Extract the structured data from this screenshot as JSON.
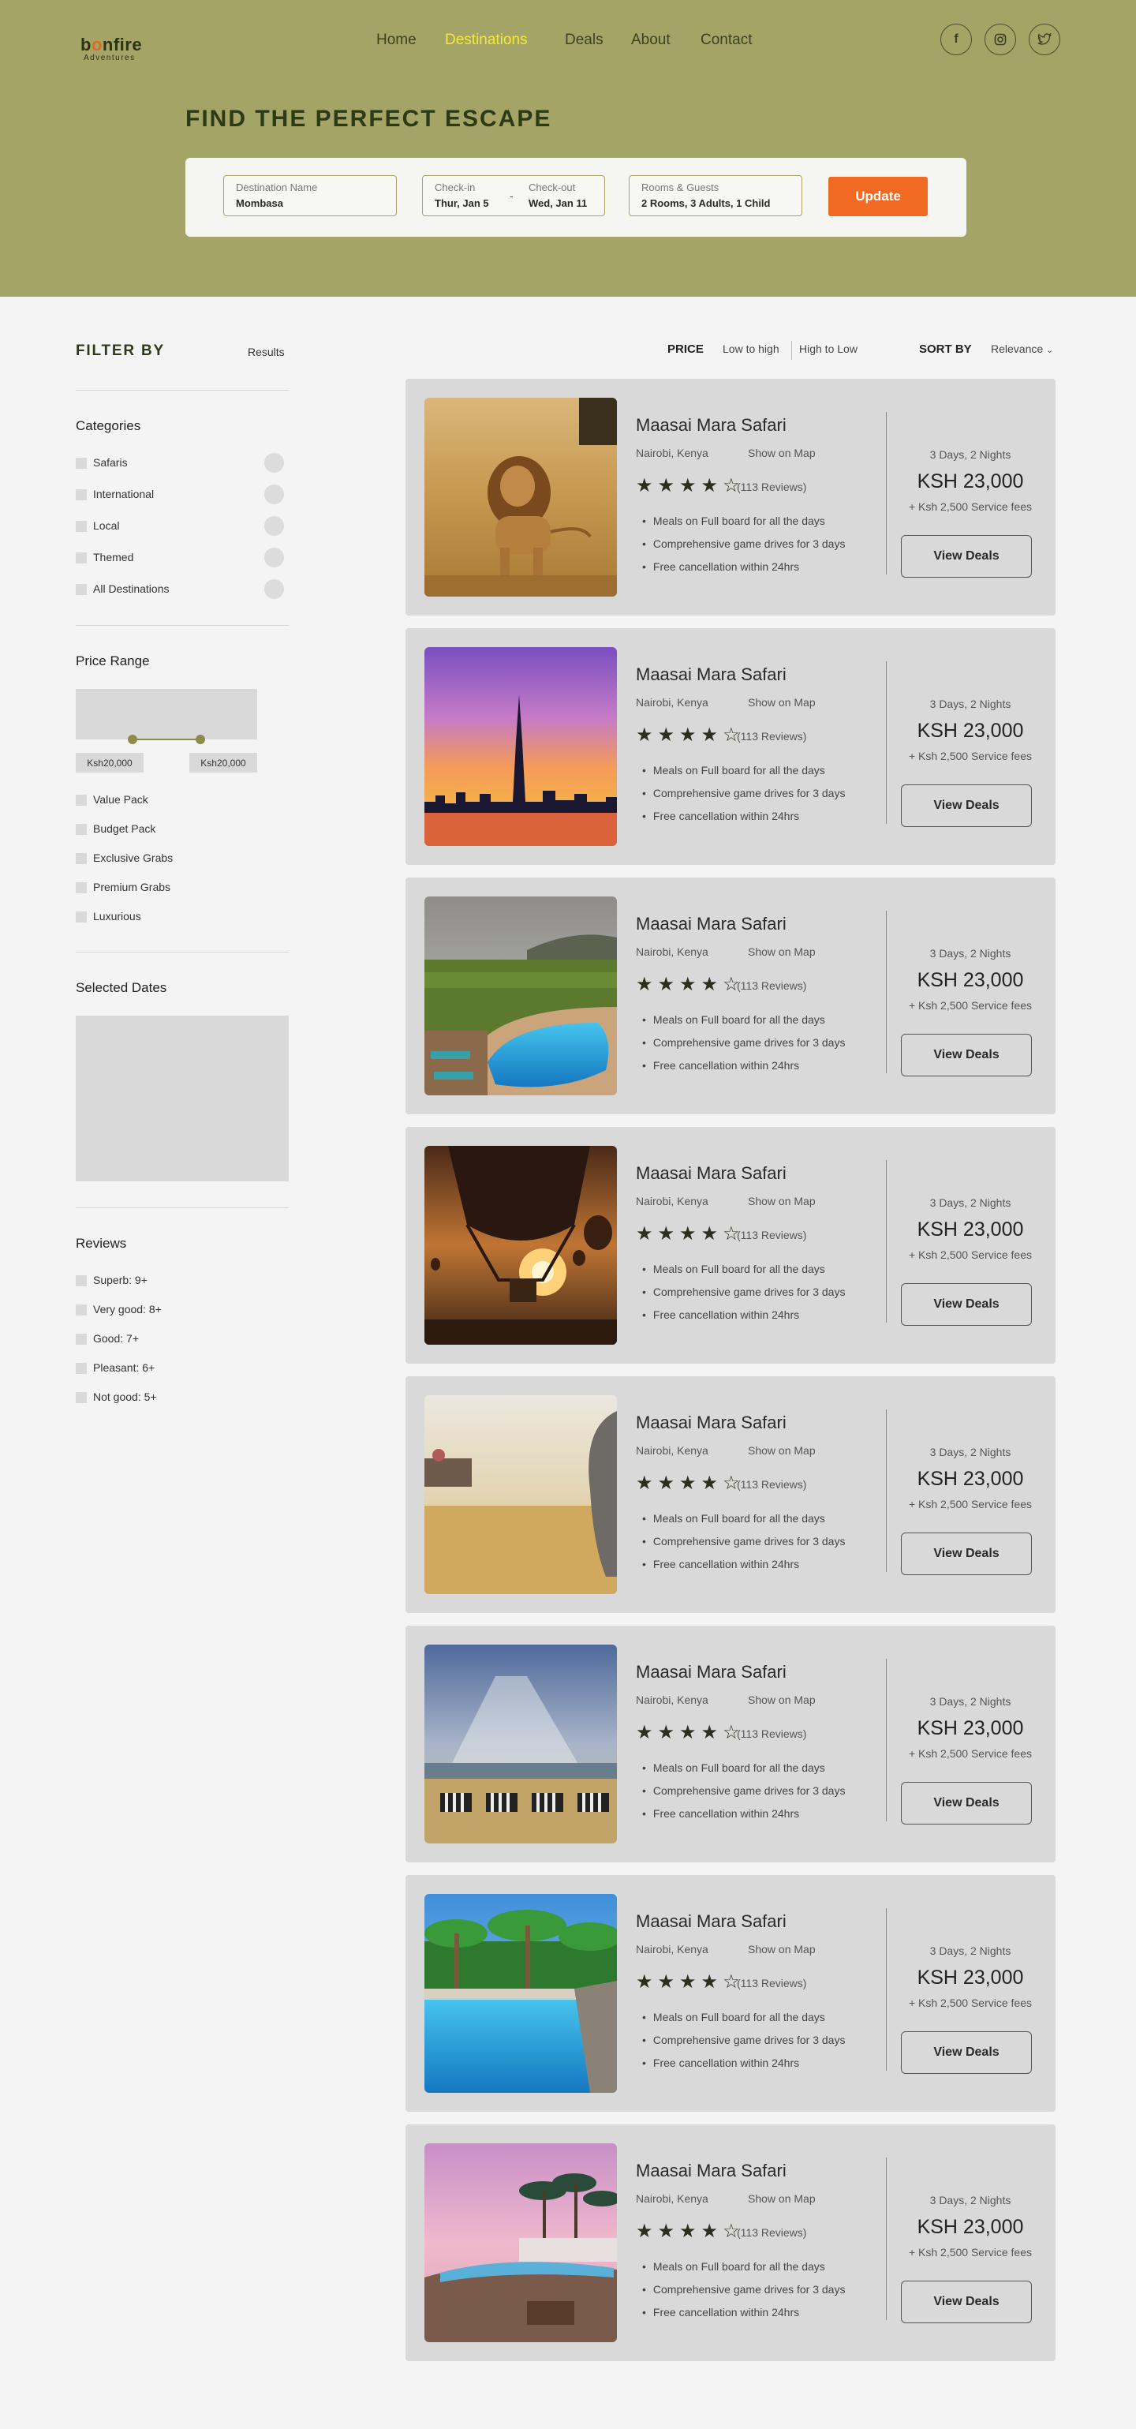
{
  "header": {
    "logo_text_pre": "b",
    "logo_text_o": "o",
    "logo_text_post": "nfire",
    "logo_sub": "Adventures",
    "nav": [
      "Home",
      "Destinations",
      "Deals",
      "About",
      "Contact"
    ],
    "active_nav": "Destinations",
    "social_icons": [
      "facebook-icon",
      "instagram-icon",
      "twitter-icon"
    ]
  },
  "hero": {
    "title": "FIND THE PERFECT ESCAPE",
    "destination_label": "Destination Name",
    "destination_value": "Mombasa",
    "checkin_label": "Check-in",
    "checkin_value": "Thur, Jan 5",
    "dash": "-",
    "checkout_label": "Check-out",
    "checkout_value": "Wed, Jan 11",
    "rooms_label": "Rooms & Guests",
    "rooms_value": "2 Rooms, 3 Adults, 1 Child",
    "update_label": "Update"
  },
  "sidebar": {
    "filter_by": "FILTER BY",
    "results": "Results",
    "categories_title": "Categories",
    "categories": [
      "Safaris",
      "International",
      "Local",
      "Themed",
      "All Destinations"
    ],
    "price_title": "Price Range",
    "price_min": "Ksh20,000",
    "price_max": "Ksh20,000",
    "packs": [
      "Value Pack",
      "Budget Pack",
      "Exclusive Grabs",
      "Premium Grabs",
      "Luxurious"
    ],
    "dates_title": "Selected Dates",
    "reviews_title": "Reviews",
    "reviews": [
      "Superb: 9+",
      "Very good: 8+",
      "Good: 7+",
      "Pleasant: 6+",
      "Not good: 5+"
    ]
  },
  "sort": {
    "price_label": "PRICE",
    "low_high": "Low to high",
    "high_low": "High to Low",
    "sort_by": "SORT BY",
    "relevance": "Relevance"
  },
  "colors": {
    "hero_bg": "#a3a466",
    "accent_orange": "#f06a24",
    "active_nav": "#f6e93a",
    "card_bg": "#d9d9d9"
  },
  "cards": [
    {
      "image": "lion-photo",
      "title": "Maasai Mara Safari",
      "location": "Nairobi, Kenya",
      "map": "Show on Map",
      "rating": 4,
      "reviews": "(113 Reviews)",
      "features": [
        "Meals on Full board for all the days",
        "Comprehensive game drives for 3 days",
        "Free cancellation within 24hrs"
      ],
      "duration": "3 Days, 2 Nights",
      "price": "KSH 23,000",
      "fee": "+ Ksh 2,500 Service fees",
      "button": "View Deals"
    },
    {
      "image": "city-skyline-sunset-photo",
      "title": "Maasai Mara Safari",
      "location": "Nairobi, Kenya",
      "map": "Show on Map",
      "rating": 4,
      "reviews": "(113 Reviews)",
      "features": [
        "Meals on Full board for all the days",
        "Comprehensive game drives for 3 days",
        "Free cancellation within 24hrs"
      ],
      "duration": "3 Days, 2 Nights",
      "price": "KSH 23,000",
      "fee": "+ Ksh 2,500 Service fees",
      "button": "View Deals"
    },
    {
      "image": "resort-pool-savanna-photo",
      "title": "Maasai Mara Safari",
      "location": "Nairobi, Kenya",
      "map": "Show on Map",
      "rating": 4,
      "reviews": "(113 Reviews)",
      "features": [
        "Meals on Full board for all the days",
        "Comprehensive game drives for 3 days",
        "Free cancellation within 24hrs"
      ],
      "duration": "3 Days, 2 Nights",
      "price": "KSH 23,000",
      "fee": "+ Ksh 2,500 Service fees",
      "button": "View Deals"
    },
    {
      "image": "hot-air-balloon-photo",
      "title": "Maasai Mara Safari",
      "location": "Nairobi, Kenya",
      "map": "Show on Map",
      "rating": 4,
      "reviews": "(113 Reviews)",
      "features": [
        "Meals on Full board for all the days",
        "Comprehensive game drives for 3 days",
        "Free cancellation within 24hrs"
      ],
      "duration": "3 Days, 2 Nights",
      "price": "KSH 23,000",
      "fee": "+ Ksh 2,500 Service fees",
      "button": "View Deals"
    },
    {
      "image": "elephant-grassland-photo",
      "title": "Maasai Mara Safari",
      "location": "Nairobi, Kenya",
      "map": "Show on Map",
      "rating": 4,
      "reviews": "(113 Reviews)",
      "features": [
        "Meals on Full board for all the days",
        "Comprehensive game drives for 3 days",
        "Free cancellation within 24hrs"
      ],
      "duration": "3 Days, 2 Nights",
      "price": "KSH 23,000",
      "fee": "+ Ksh 2,500 Service fees",
      "button": "View Deals"
    },
    {
      "image": "zebras-sunrays-photo",
      "title": "Maasai Mara Safari",
      "location": "Nairobi, Kenya",
      "map": "Show on Map",
      "rating": 4,
      "reviews": "(113 Reviews)",
      "features": [
        "Meals on Full board for all the days",
        "Comprehensive game drives for 3 days",
        "Free cancellation within 24hrs"
      ],
      "duration": "3 Days, 2 Nights",
      "price": "KSH 23,000",
      "fee": "+ Ksh 2,500 Service fees",
      "button": "View Deals"
    },
    {
      "image": "palm-pool-resort-photo",
      "title": "Maasai Mara Safari",
      "location": "Nairobi, Kenya",
      "map": "Show on Map",
      "rating": 4,
      "reviews": "(113 Reviews)",
      "features": [
        "Meals on Full board for all the days",
        "Comprehensive game drives for 3 days",
        "Free cancellation within 24hrs"
      ],
      "duration": "3 Days, 2 Nights",
      "price": "KSH 23,000",
      "fee": "+ Ksh 2,500 Service fees",
      "button": "View Deals"
    },
    {
      "image": "beach-resort-dusk-photo",
      "title": "Maasai Mara Safari",
      "location": "Nairobi, Kenya",
      "map": "Show on Map",
      "rating": 4,
      "reviews": "(113 Reviews)",
      "features": [
        "Meals on Full board for all the days",
        "Comprehensive game drives for 3 days",
        "Free cancellation within 24hrs"
      ],
      "duration": "3 Days, 2 Nights",
      "price": "KSH 23,000",
      "fee": "+ Ksh 2,500 Service fees",
      "button": "View Deals"
    }
  ]
}
